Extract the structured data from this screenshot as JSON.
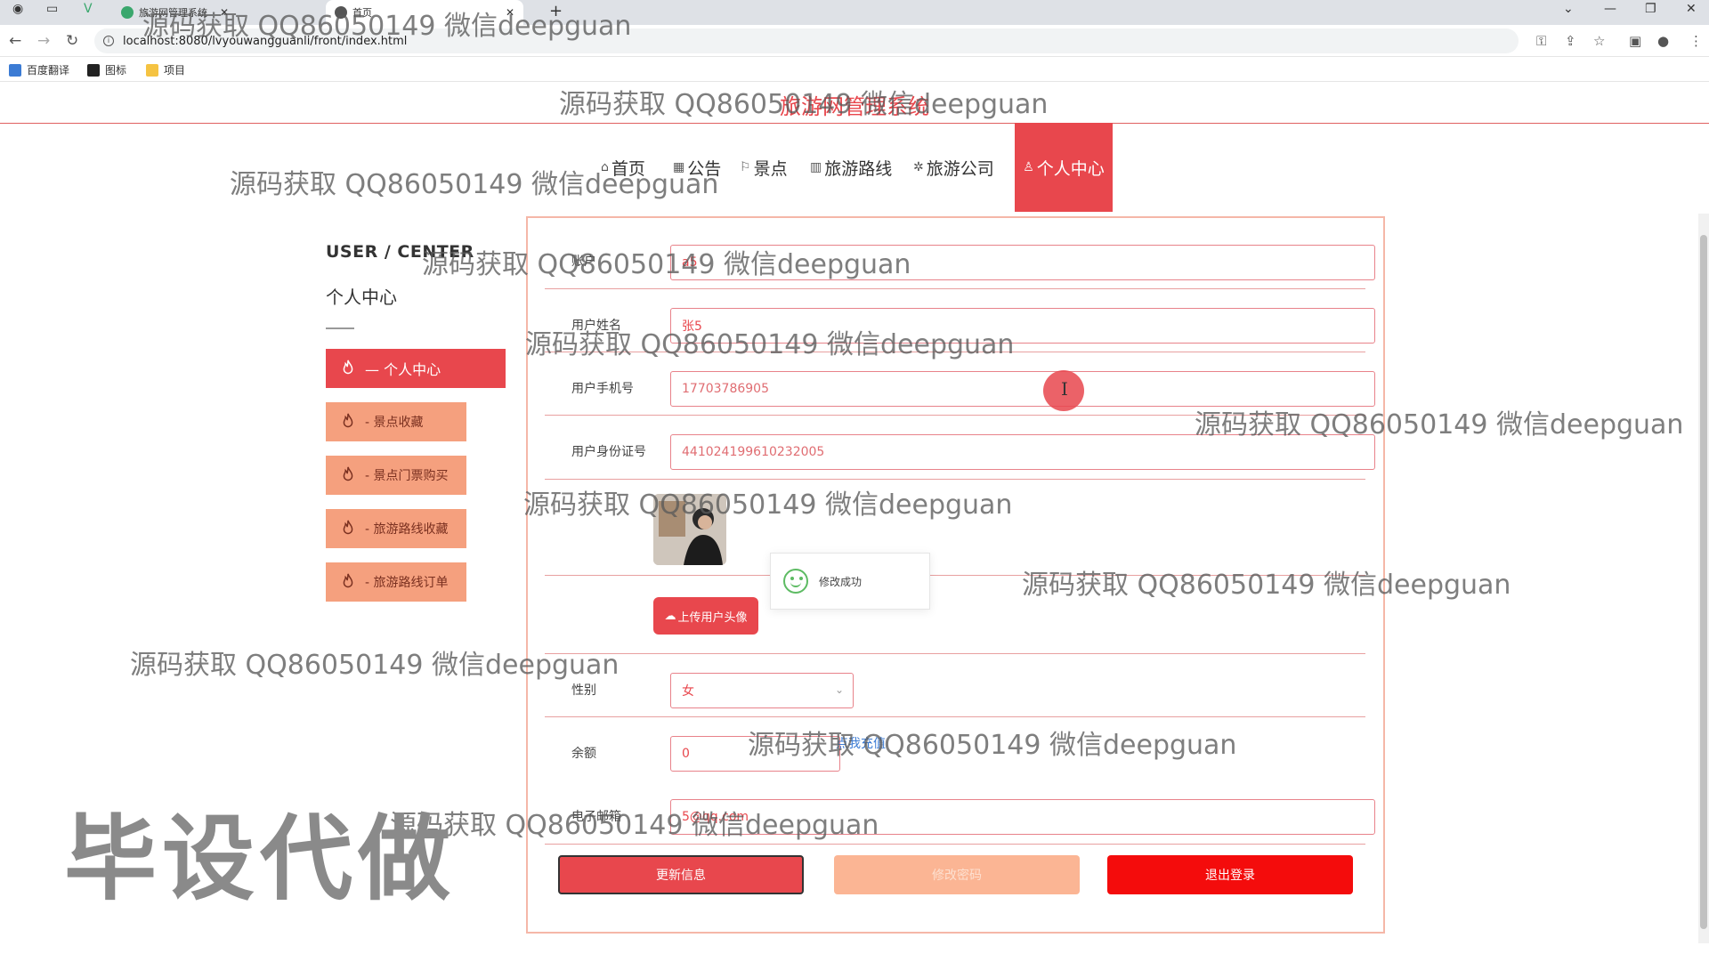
{
  "browser": {
    "tabs": [
      {
        "label": "旅游网管理系统",
        "active": false
      },
      {
        "label": "首页",
        "active": true
      }
    ],
    "url": "localhost:8080/lvyouwangguanli/front/index.html",
    "bookmarks": [
      "百度翻译",
      "图标",
      "项目"
    ]
  },
  "site": {
    "title": "旅游网管理系统",
    "nav": [
      {
        "label": "首页",
        "icon": "home-icon"
      },
      {
        "label": "公告",
        "icon": "notice-icon"
      },
      {
        "label": "景点",
        "icon": "flag-icon"
      },
      {
        "label": "旅游路线",
        "icon": "route-icon"
      },
      {
        "label": "旅游公司",
        "icon": "company-icon"
      },
      {
        "label": "个人中心",
        "icon": "user-icon",
        "active": true
      }
    ]
  },
  "sidebar": {
    "title_en": "USER / CENTER",
    "title_cn": "个人中心",
    "main_item": "— 个人中心",
    "items": [
      "- 景点收藏",
      "- 景点门票购买",
      "- 旅游路线收藏",
      "- 旅游路线订单"
    ]
  },
  "form": {
    "account_label": "账户",
    "account_value": "a5",
    "name_label": "用户姓名",
    "name_value": "张5",
    "phone_label": "用户手机号",
    "phone_value": "17703786905",
    "idcard_label": "用户身份证号",
    "idcard_value": "441024199610232005",
    "upload_label": "上传用户头像",
    "toast_text": "修改成功",
    "gender_label": "性别",
    "gender_value": "女",
    "balance_label": "余额",
    "balance_value": "0",
    "recharge_label": "点我充值",
    "email_label": "电子邮箱",
    "email_value": "5@qq.com",
    "btn_update": "更新信息",
    "btn_password": "修改密码",
    "btn_logout": "退出登录"
  },
  "watermarks": {
    "text": "源码获取 QQ86050149 微信deepguan",
    "big": "毕设代做"
  },
  "colors": {
    "accent": "#e8474d",
    "sub_button": "#f5a07e",
    "logout": "#f40c0c",
    "toast_icon": "#5dbb63"
  }
}
